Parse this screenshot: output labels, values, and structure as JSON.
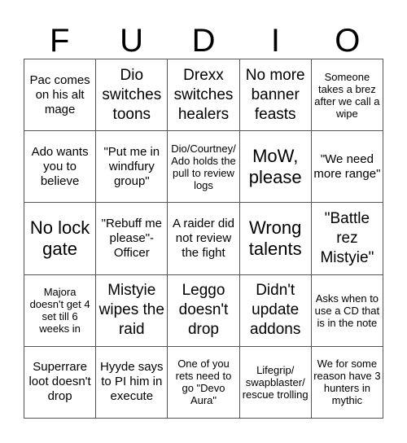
{
  "header": {
    "letters": [
      "F",
      "U",
      "D",
      "I",
      "O"
    ]
  },
  "card": {
    "rows": [
      [
        "Pac comes on his alt mage",
        "Dio switches toons",
        "Drexx switches healers",
        "No more banner feasts",
        "Someone takes a brez after we call a wipe"
      ],
      [
        "Ado wants you to believe",
        "\"Put me in windfury group\"",
        "Dio/Courtney/ Ado holds the pull to review logs",
        "MoW, please",
        "\"We need more range\""
      ],
      [
        "No lock gate",
        "\"Rebuff me please\"- Officer",
        "A raider did not review the fight",
        "Wrong talents",
        "\"Battle rez Mistyie\""
      ],
      [
        "Majora doesn't get 4 set till 6 weeks in",
        "Mistyie wipes the raid",
        "Leggo doesn't drop",
        "Didn't update addons",
        "Asks when to use a CD that is in the note"
      ],
      [
        "Superrare loot doesn't drop",
        "Hyyde says to PI him in execute",
        "One of you rets need to go \"Devo Aura\"",
        "Lifegrip/ swapblaster/ rescue trolling",
        "We for some reason have 3 hunters in mythic"
      ]
    ]
  }
}
